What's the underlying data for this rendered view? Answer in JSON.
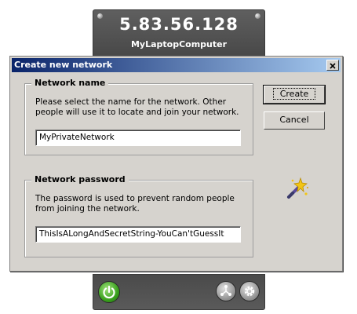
{
  "app": {
    "ip_address": "5.83.56.128",
    "computer_name": "MyLaptopComputer",
    "power_icon": "power-icon",
    "network_icon": "network-icon",
    "settings_icon": "gear-icon"
  },
  "dialog": {
    "title": "Create new network",
    "close_icon": "close-icon",
    "network_name": {
      "legend": "Network name",
      "description": "Please select the name for the network. Other people will use it to locate and join your network.",
      "value": "MyPrivateNetwork"
    },
    "network_password": {
      "legend": "Network password",
      "description": "The password is used to prevent random people from joining the network.",
      "value": "ThisIsALongAndSecretString-YouCan'tGuessIt"
    },
    "buttons": {
      "create": "Create",
      "cancel": "Cancel"
    },
    "wizard_icon": "magic-wand-icon"
  },
  "colors": {
    "titlebar_start": "#0a246a",
    "titlebar_end": "#a6caf0",
    "dialog_bg": "#d6d3ce",
    "panel_bg": "#4f4f4f",
    "power_green": "#3aa11e"
  }
}
